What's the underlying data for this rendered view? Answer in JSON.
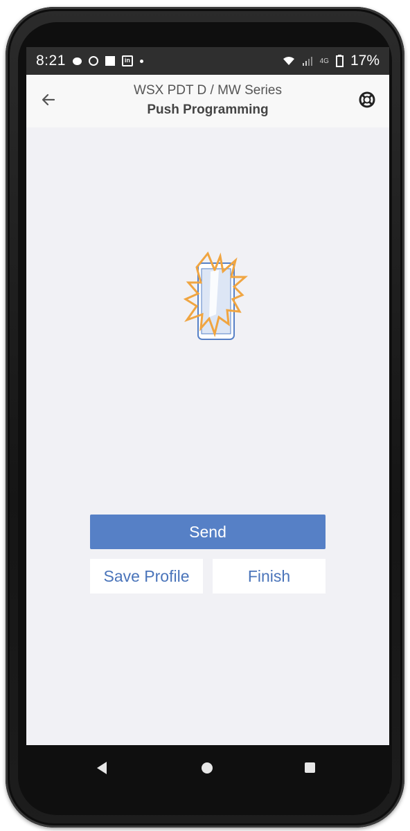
{
  "status_bar": {
    "time": "8:21",
    "battery": "17%",
    "network": "4G",
    "icons": [
      "chat-icon",
      "pinterest-icon",
      "notification-square-icon",
      "linkedin-icon",
      "more-dot-icon",
      "wifi-icon",
      "signal-icon",
      "battery-icon"
    ]
  },
  "header": {
    "title": "WSX PDT D / MW Series",
    "subtitle": "Push Programming",
    "back_icon": "arrow-left-icon",
    "help_icon": "lifebuoy-icon"
  },
  "illustration": {
    "icon": "phone-burst-icon",
    "colors": {
      "phone_outline": "#5680c6",
      "burst": "#f0a541"
    }
  },
  "actions": {
    "send_label": "Send",
    "save_profile_label": "Save Profile",
    "finish_label": "Finish"
  },
  "colors": {
    "accent": "#5680c6",
    "link_text": "#4a74ba",
    "background": "#f1f1f5",
    "header_bg": "#f8f8f8",
    "status_bar": "#2f2f2f"
  },
  "nav_bar": {
    "icons": [
      "nav-back-icon",
      "nav-home-icon",
      "nav-recents-icon"
    ]
  }
}
